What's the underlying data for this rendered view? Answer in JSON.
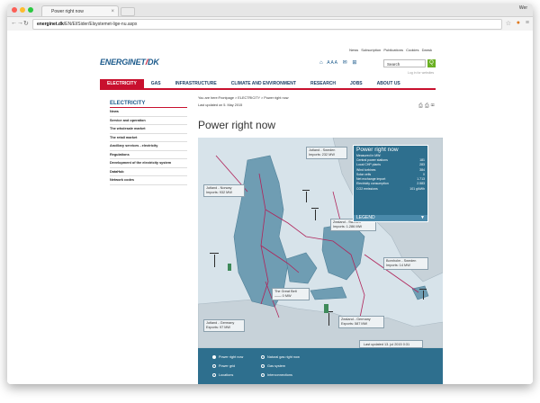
{
  "browser": {
    "tab_title": "Power right now",
    "tab_close": "×",
    "user_label": "Wer",
    "url_host": "energinet.dk",
    "url_path": "/EN/El/Sider/Elsystemet-lige-nu.aspx",
    "colors": {
      "close": "#fc5f57",
      "minimize": "#fdbc2e",
      "maximize": "#2ac840"
    }
  },
  "header": {
    "top_links": [
      "News",
      "Subscription",
      "Publications",
      "Cookies",
      "Dansk"
    ],
    "logo_a": "ENERGINET",
    "logo_b": "DK",
    "text_size_label": "A A A",
    "search_placeholder": "Search",
    "search_button": "Q",
    "login_label": "Log in for websites"
  },
  "nav": {
    "items": [
      "ELECTRICITY",
      "GAS",
      "INFRASTRUCTURE",
      "CLIMATE AND ENVIRONMENT",
      "RESEARCH",
      "JOBS",
      "ABOUT US"
    ],
    "active": "ELECTRICITY"
  },
  "sidebar": {
    "title": "ELECTRICITY",
    "items": [
      "News",
      "Service and operation",
      "The wholesale market",
      "The retail market",
      "Ancillary services - electricity",
      "Regulations",
      "Development of the electricity system",
      "DataHub",
      "Network codes"
    ]
  },
  "content": {
    "breadcrumb": "You are here:Frontpage > ELECTRICITY > Power right now",
    "last_updated": "Last updated on 5. May 2015",
    "title": "Power right now"
  },
  "map": {
    "labels": [
      {
        "title": "Jutland - Norway",
        "value": "Imports:  932 MW"
      },
      {
        "title": "Jutland - Sweden",
        "value": "Imports:  232 MW"
      },
      {
        "title": "Zealand - Sweden",
        "value": "Imports:  1.286 MW"
      },
      {
        "title": "Bornholm - Sweden",
        "value": "Imports:  14 MW"
      },
      {
        "title": "The Great Belt",
        "value": "—— 0 MW"
      },
      {
        "title": "Jutland - Germany",
        "value": "Exports:  97 MW"
      },
      {
        "title": "Zealand - Germany",
        "value": "Exports:  587 MW"
      }
    ],
    "panel": {
      "title": "Power right now",
      "subtitle": "Measured in MW:",
      "rows": [
        {
          "label": "Central power stations",
          "value": "181"
        },
        {
          "label": "Local CHP plants",
          "value": "283"
        },
        {
          "label": "Wind turbines",
          "value": "384"
        },
        {
          "label": "Solar cells",
          "value": "0"
        },
        {
          "label": "Net exchange import",
          "value": "1.713"
        },
        {
          "label": "Electricity consumption",
          "value": "2.583"
        },
        {
          "label": "CO2 emissions",
          "value": "101 g/kWh"
        }
      ],
      "legend_label": "LEGEND"
    },
    "last_updated": "Last updated  13. jul 2015 0:31"
  },
  "options": [
    {
      "label": "Power right now",
      "selected": true
    },
    {
      "label": "Natural gas right now",
      "selected": false
    },
    {
      "label": "Power grid",
      "selected": false
    },
    {
      "label": "Gas system",
      "selected": false
    },
    {
      "label": "Locations",
      "selected": false
    },
    {
      "label": "Interconnections",
      "selected": false
    }
  ]
}
